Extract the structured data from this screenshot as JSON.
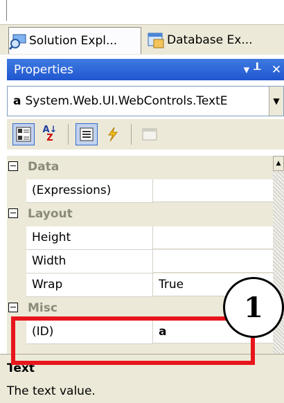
{
  "tabs": [
    {
      "label": "Solution Expl...",
      "icon": "solution-explorer-icon",
      "active": true
    },
    {
      "label": "Database Ex...",
      "icon": "database-explorer-icon",
      "active": false
    }
  ],
  "panel": {
    "title": "Properties",
    "pin_glyph": "▾ ┸",
    "close_glyph": "✕",
    "pin_icon": "pin-icon",
    "close_icon": "close-icon"
  },
  "object_selector": {
    "name": "a",
    "type": "System.Web.UI.WebControls.TextE"
  },
  "toolbar": {
    "az_label": "A↓",
    "az_sub": "Z",
    "icons": [
      "categorized-icon",
      "alphabetical-icon",
      "properties-icon",
      "events-icon",
      "property-pages-icon"
    ]
  },
  "grid": {
    "categories": [
      {
        "label": "Data",
        "properties": [
          {
            "name": "(Expressions)",
            "value": ""
          }
        ]
      },
      {
        "label": "Layout",
        "properties": [
          {
            "name": "Height",
            "value": ""
          },
          {
            "name": "Width",
            "value": ""
          },
          {
            "name": "Wrap",
            "value": "True"
          }
        ]
      },
      {
        "label": "Misc",
        "properties": [
          {
            "name": "(ID)",
            "value": "a"
          }
        ]
      }
    ]
  },
  "description": {
    "title": "Text",
    "text": "The text value."
  },
  "annotation": {
    "callout_number": "1",
    "highlight_color": "#e8161c"
  },
  "colors": {
    "titlebar": "#2a63d8",
    "panel_bg": "#ece9d8",
    "category_text": "#8a8a7a"
  }
}
